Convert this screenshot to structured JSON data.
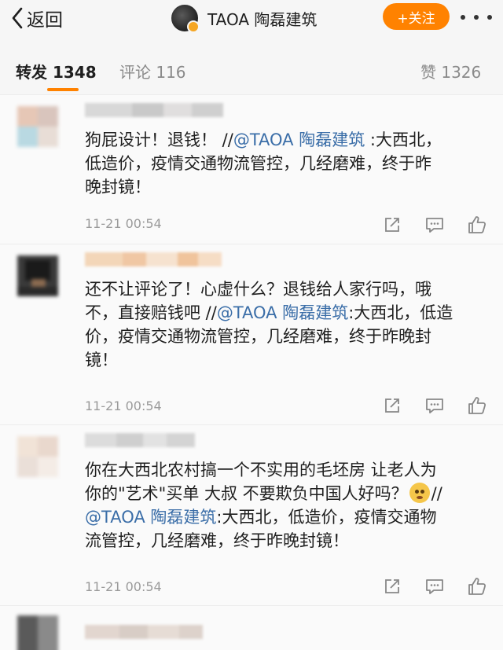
{
  "header": {
    "back_label": "返回",
    "account_name": "TAOA 陶磊建筑",
    "follow_label": "+关注"
  },
  "tabs": {
    "repost_label": "转发",
    "repost_count": "1348",
    "comment_label": "评论",
    "comment_count": "116",
    "like_label": "赞",
    "like_count": "1326"
  },
  "reposts": [
    {
      "line1_a": "狗屁设计！退钱！ //",
      "line1_mention": "@TAOA 陶磊建筑",
      "line1_b": " :大西北，",
      "line2": "低造价，疫情交通物流管控，几经磨难，终于昨",
      "line3": "晚封镜！",
      "time": "11-21 00:54"
    },
    {
      "line1": "还不让评论了！心虚什么？退钱给人家行吗，哦",
      "line2_a": "不，直接赔钱吧 //",
      "line2_mention": "@TAOA 陶磊建筑",
      "line2_b": ":大西北，低造",
      "line3": "价，疫情交通物流管控，几经磨难，终于昨晚封",
      "line4": "镜！",
      "time": "11-21 00:54"
    },
    {
      "line1": "你在大西北农村搞一个不实用的毛坯房 让老人为",
      "line2_a": "你的\"艺术\"买单 大叔 不要欺负中国人好吗？",
      "line2_b": "//",
      "line3_mention": "@TAOA 陶磊建筑",
      "line3_b": ":大西北，低造价，疫情交通物",
      "line4": "流管控，几经磨难，终于昨晚封镜！",
      "time": "11-21 00:54"
    }
  ],
  "icons": {
    "share": "share-icon",
    "comment": "comment-icon",
    "like": "thumbs-up-icon",
    "emoji": "pleading-face-emoji-icon"
  },
  "colors": {
    "accent": "#ff8200",
    "mention": "#3b6ea8",
    "muted": "#9a9a9a"
  }
}
